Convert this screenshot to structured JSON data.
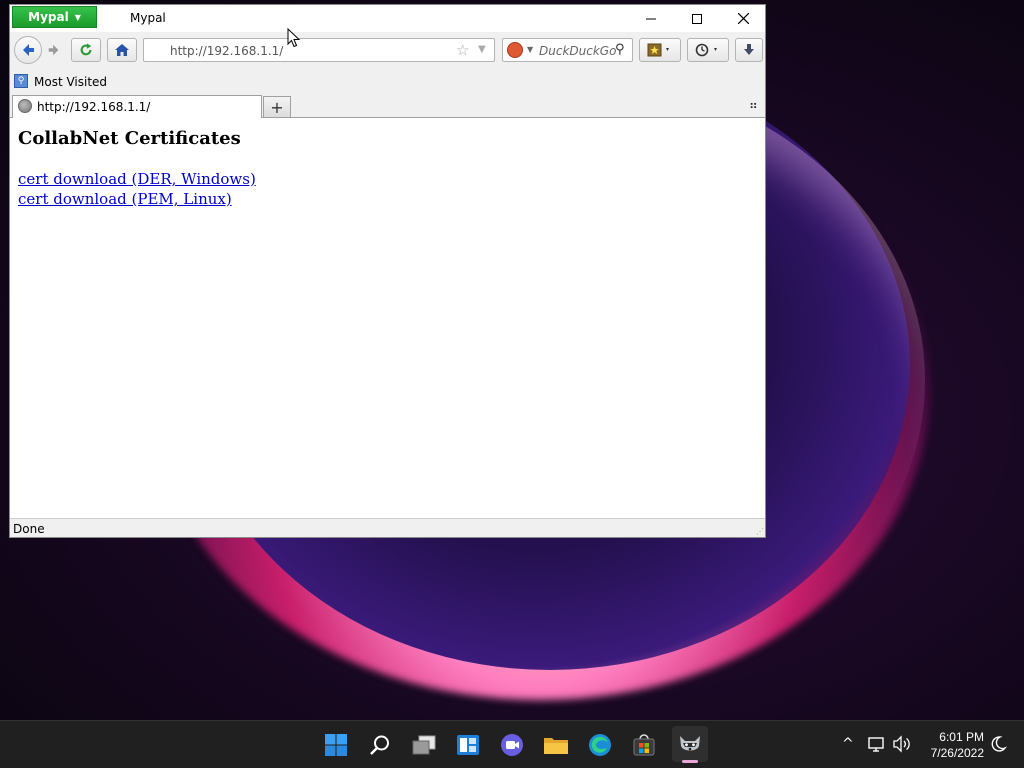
{
  "window": {
    "app_menu_label": "Mypal",
    "title": "Mypal"
  },
  "navbar": {
    "url_value": "http://192.168.1.1/",
    "search_placeholder": "DuckDuckGo"
  },
  "bookmarks_bar": {
    "items": [
      {
        "label": "Most Visited",
        "icon": "bookmark-folder-icon"
      }
    ]
  },
  "tabs": [
    {
      "label": "http://192.168.1.1/",
      "active": true,
      "icon": "globe-icon"
    }
  ],
  "page": {
    "heading": "CollabNet Certificates",
    "links": [
      {
        "label": "cert download (DER, Windows)"
      },
      {
        "label": "cert download (PEM, Linux)"
      }
    ]
  },
  "status": {
    "text": "Done"
  },
  "taskbar": {
    "pinned": [
      {
        "name": "start",
        "icon": "windows-logo-icon"
      },
      {
        "name": "search",
        "icon": "search-icon"
      },
      {
        "name": "task-view",
        "icon": "task-view-icon"
      },
      {
        "name": "widgets",
        "icon": "widgets-icon"
      },
      {
        "name": "chat",
        "icon": "chat-icon"
      },
      {
        "name": "file-explorer",
        "icon": "folder-icon"
      },
      {
        "name": "edge",
        "icon": "edge-icon"
      },
      {
        "name": "store",
        "icon": "store-icon"
      },
      {
        "name": "mypal",
        "icon": "mypal-icon",
        "active": true
      }
    ],
    "clock": {
      "time": "6:01 PM",
      "date": "7/26/2022"
    }
  },
  "colors": {
    "app_menu": "#1a9a2b",
    "link": "#0000cc",
    "taskbar": "#202020",
    "active_indicator": "#e9a7d8"
  }
}
